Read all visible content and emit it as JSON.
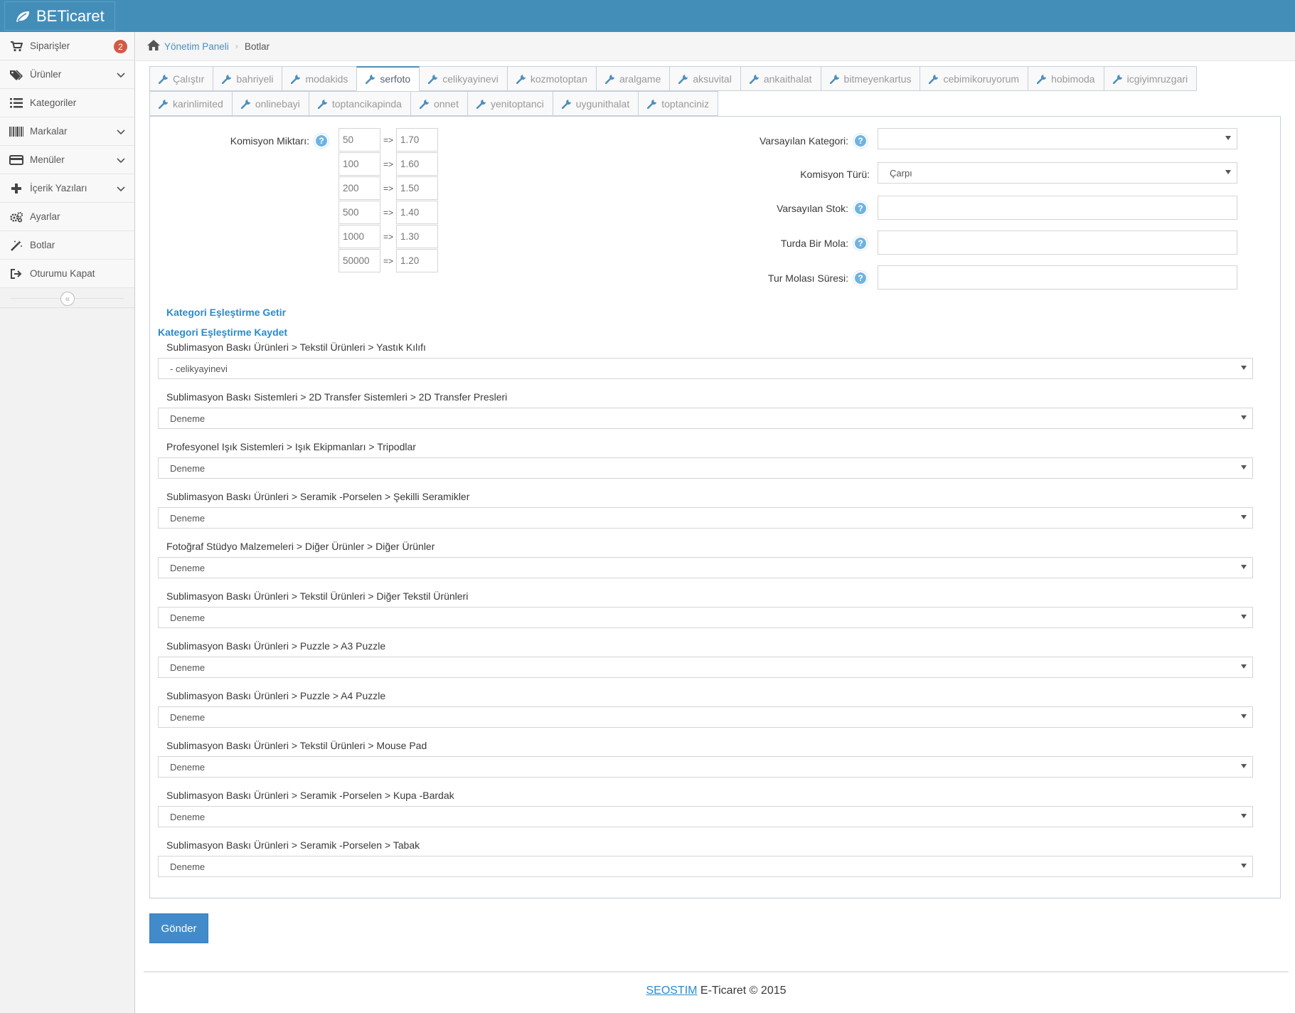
{
  "app": {
    "title": "BETicaret"
  },
  "sidebar": {
    "items": [
      {
        "label": "Siparişler",
        "icon": "cart-icon",
        "badge": "2"
      },
      {
        "label": "Ürünler",
        "icon": "tags-icon",
        "chevron": true
      },
      {
        "label": "Kategoriler",
        "icon": "list-icon"
      },
      {
        "label": "Markalar",
        "icon": "barcode-icon",
        "chevron": true
      },
      {
        "label": "Menüler",
        "icon": "credit-card-icon",
        "chevron": true
      },
      {
        "label": "İçerik Yazıları",
        "icon": "plus-icon",
        "chevron": true
      },
      {
        "label": "Ayarlar",
        "icon": "cogs-icon"
      },
      {
        "label": "Botlar",
        "icon": "magic-wand-icon"
      },
      {
        "label": "Oturumu Kapat",
        "icon": "sign-out-icon"
      }
    ],
    "collapse_symbol": "«"
  },
  "breadcrumb": {
    "home": "Yönetim Paneli",
    "current": "Botlar"
  },
  "tabs": {
    "row1": [
      "Çalıştır",
      "bahriyeli",
      "modakids",
      "serfoto",
      "celikyayinevi",
      "kozmotoptan",
      "aralgame",
      "aksuvital",
      "ankaithalat",
      "bitmeyenkartus",
      "cebimikoruyorum",
      "hobimoda",
      "icgiyimruzgari"
    ],
    "row2": [
      "karinlimited",
      "onlinebayi",
      "toptancikapinda",
      "onnet",
      "yenitoptanci",
      "uygunithalat",
      "toptanciniz"
    ],
    "active": "serfoto"
  },
  "form": {
    "komisyon_label": "Komisyon Miktarı:",
    "komisyon": [
      {
        "min": "50",
        "rate": "1.70"
      },
      {
        "min": "100",
        "rate": "1.60"
      },
      {
        "min": "200",
        "rate": "1.50"
      },
      {
        "min": "500",
        "rate": "1.40"
      },
      {
        "min": "1000",
        "rate": "1.30"
      },
      {
        "min": "50000",
        "rate": "1.20"
      }
    ],
    "arrow": "=>",
    "help": "?",
    "varsayilan_kategori_label": "Varsayılan Kategori:",
    "varsayilan_kategori_value": "",
    "komisyon_turu_label": "Komisyon Türü:",
    "komisyon_turu_value": "Çarpı",
    "varsayilan_stok_label": "Varsayılan Stok:",
    "turda_bir_mola_label": "Turda Bir Mola:",
    "tur_molasi_suresi_label": "Tur Molası Süresi:"
  },
  "links": {
    "getir": "Kategori Eşleştirme Getir",
    "kaydet": "Kategori Eşleştirme Kaydet"
  },
  "mappings": [
    {
      "label": "Sublimasyon Baskı Ürünleri > Tekstil Ürünleri > Yastık Kılıfı",
      "value": "- celikyayinevi"
    },
    {
      "label": "Sublimasyon Baskı Sistemleri > 2D Transfer Sistemleri > 2D Transfer Presleri",
      "value": "Deneme"
    },
    {
      "label": "Profesyonel Işık Sistemleri > Işık Ekipmanları > Tripodlar",
      "value": "Deneme"
    },
    {
      "label": "Sublimasyon Baskı Ürünleri > Seramik -Porselen > Şekilli Seramikler",
      "value": "Deneme"
    },
    {
      "label": "Fotoğraf Stüdyo Malzemeleri > Diğer Ürünler > Diğer Ürünler",
      "value": "Deneme"
    },
    {
      "label": "Sublimasyon Baskı Ürünleri > Tekstil Ürünleri > Diğer Tekstil Ürünleri",
      "value": "Deneme"
    },
    {
      "label": "Sublimasyon Baskı Ürünleri > Puzzle > A3 Puzzle",
      "value": "Deneme"
    },
    {
      "label": "Sublimasyon Baskı Ürünleri > Puzzle > A4 Puzzle",
      "value": "Deneme"
    },
    {
      "label": "Sublimasyon Baskı Ürünleri > Tekstil Ürünleri > Mouse Pad",
      "value": "Deneme"
    },
    {
      "label": "Sublimasyon Baskı Ürünleri > Seramik -Porselen > Kupa -Bardak",
      "value": "Deneme"
    },
    {
      "label": "Sublimasyon Baskı Ürünleri > Seramik -Porselen > Tabak",
      "value": "Deneme"
    }
  ],
  "submit_label": "Gönder",
  "footer": {
    "brand": "SEOSTIM",
    "text": " E-Ticaret © 2015"
  },
  "colors": {
    "navbar": "#438eb9",
    "accent": "#4c8fbd",
    "button": "#428bca",
    "badge": "#d15b47",
    "help": "#6fb3e0"
  }
}
